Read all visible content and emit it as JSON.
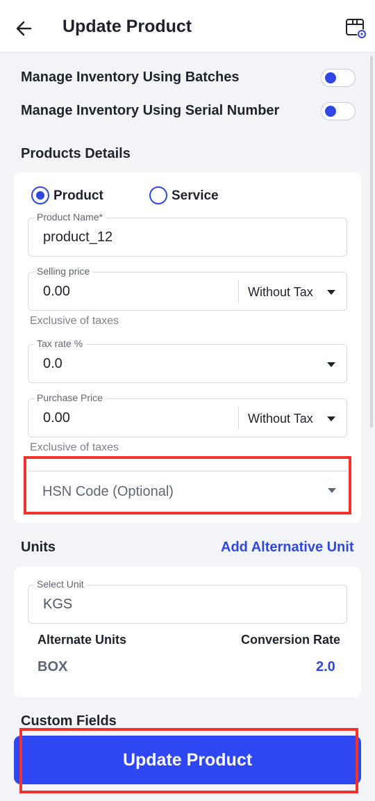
{
  "header": {
    "title": "Update Product",
    "back_icon": "arrow-left-icon",
    "settings_icon": "box-settings-icon"
  },
  "inventory": {
    "batches_label": "Manage Inventory Using Batches",
    "batches_enabled": false,
    "serial_label": "Manage Inventory Using Serial Number",
    "serial_enabled": false
  },
  "details": {
    "section_title": "Products Details",
    "type_options": [
      {
        "label": "Product",
        "selected": true
      },
      {
        "label": "Service",
        "selected": false
      }
    ],
    "product_name": {
      "label": "Product Name*",
      "value": "product_12"
    },
    "selling_price": {
      "label": "Selling price",
      "value": "0.00",
      "tax_mode": "Without Tax",
      "hint": "Exclusive of taxes"
    },
    "tax_rate": {
      "label": "Tax rate %",
      "value": "0.0"
    },
    "purchase_price": {
      "label": "Purchase Price",
      "value": "0.00",
      "tax_mode": "Without Tax",
      "hint": "Exclusive of taxes"
    },
    "hsn": {
      "placeholder": "HSN Code (Optional)"
    }
  },
  "units": {
    "section_title": "Units",
    "add_link": "Add Alternative Unit",
    "select_unit": {
      "label": "Select Unit",
      "value": "KGS"
    },
    "alternate_header": "Alternate Units",
    "rate_header": "Conversion Rate",
    "rows": [
      {
        "unit": "BOX",
        "rate": "2.0"
      }
    ]
  },
  "custom_fields": {
    "title": "Custom Fields"
  },
  "footer": {
    "update_label": "Update Product"
  },
  "colors": {
    "accent": "#2e47f2",
    "highlight": "#f0332b"
  }
}
